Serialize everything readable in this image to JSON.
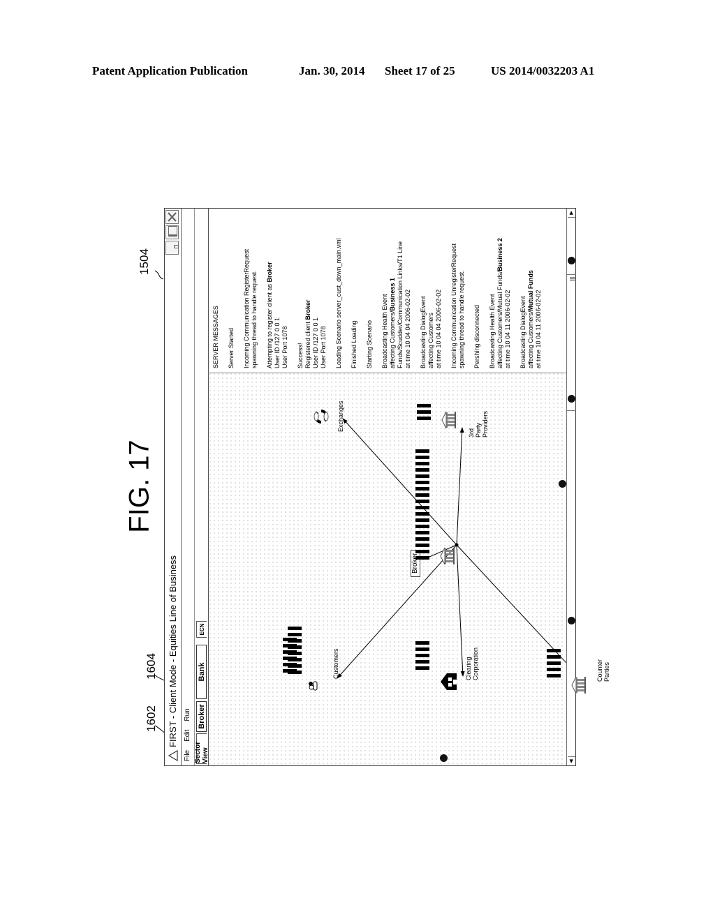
{
  "page_header": {
    "publication": "Patent Application Publication",
    "date": "Jan. 30, 2014",
    "sheet": "Sheet 17 of 25",
    "patent_number": "US 2014/0032203 A1"
  },
  "figure_label": "FIG. 17",
  "reference_numerals": {
    "r1504": "1504",
    "r1602": "1602",
    "r1604": "1604"
  },
  "window": {
    "title": "FIRST - Client Mode - Equities Line of Business",
    "controls": [
      "minimize-icon",
      "maximize-icon",
      "close-icon"
    ],
    "menu": [
      {
        "label": "File"
      },
      {
        "label": "Edit"
      },
      {
        "label": "Run"
      }
    ],
    "tabs": [
      {
        "label": "Sector View"
      },
      {
        "label": "Broker"
      },
      {
        "label": "Bank"
      },
      {
        "label": "ECN"
      }
    ],
    "active_tab": "Sector View"
  },
  "diagram": {
    "nodes": [
      {
        "id": "customers",
        "label": "Customers",
        "icon": "people-icon",
        "bars": 6
      },
      {
        "id": "clearing",
        "label_lines": [
          "Clearing",
          "Corporation"
        ],
        "icon": "house-icon",
        "bars": 5
      },
      {
        "id": "counter",
        "label_lines": [
          "Counter",
          "Parties"
        ],
        "icon": "building-icon",
        "bars": 5
      },
      {
        "id": "broker",
        "label": "Broker",
        "icon": "building-icon",
        "bars": 18
      },
      {
        "id": "exchanges",
        "label": "Exchanges",
        "icon": "exchange-cycle-icon",
        "bars": 8
      },
      {
        "id": "thirdparty",
        "label_lines": [
          "3rd",
          "Party",
          "Providers"
        ],
        "icon": "building-icon",
        "bars": 3
      }
    ]
  },
  "server_messages": {
    "title": "SERVER MESSAGES",
    "messages": [
      {
        "lines": [
          "Server Started"
        ]
      },
      {
        "lines": [
          "Incoming Communication RegisterRequest",
          "spawning thread to handle request."
        ]
      },
      {
        "lines": [
          "Attempting to register client as |Broker|",
          "User ID /127 0 0 1",
          "User Port 1078"
        ]
      },
      {
        "lines": [
          "Success!",
          "Registered client |Broker|",
          "User ID /127 0 0 1",
          "User Port 1078"
        ]
      },
      {
        "lines": [
          "Loading Scenario server_cust_down_main.vml"
        ]
      },
      {
        "lines": [
          "Finished Loading"
        ]
      },
      {
        "lines": [
          "Starting Scenario"
        ]
      },
      {
        "lines": [
          "Broadcasting Health Event",
          "affecting Customers/|Business 1|",
          "Funds/Scudder/Communication Links/T1 Line",
          "at time  10 04 04 2006-02-02"
        ]
      },
      {
        "lines": [
          "Broadcasting DialogEvent",
          "affecting Customers",
          "at time  10 04 04 2006-02-02"
        ]
      },
      {
        "lines": [
          "Incoming Communication UnregisterRequest",
          "spawning thread to handle request."
        ]
      },
      {
        "lines": [
          "Pershing disconnected"
        ]
      },
      {
        "lines": [
          "Broadcasting Health Event",
          "affecting Customers/Mutual Funds/|Business 2|",
          "at time  10 04 11 2006-02-02"
        ]
      },
      {
        "lines": [
          "Broadcasting DialogEvent",
          "affecting Customers/|Mutual Funds|",
          "at time  10 04 11 2006-02-02"
        ]
      }
    ]
  }
}
